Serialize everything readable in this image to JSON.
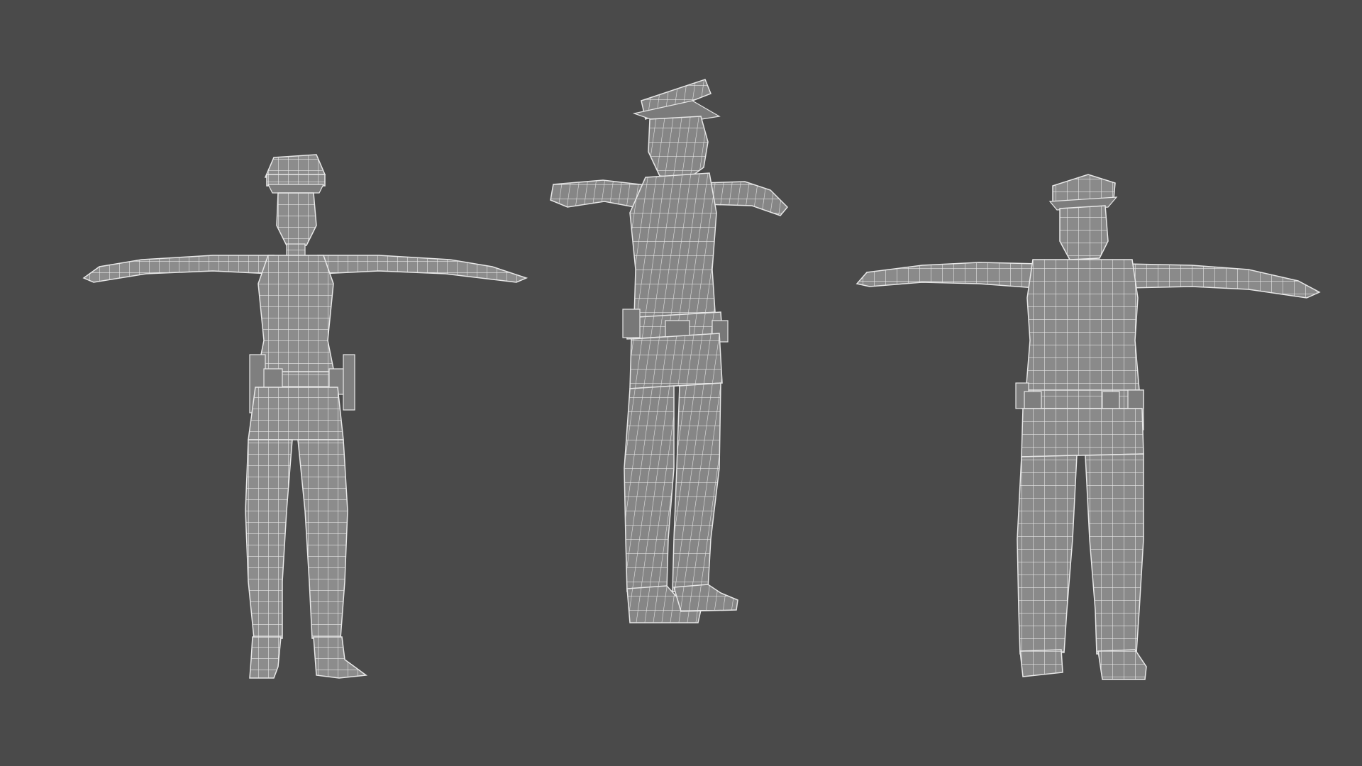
{
  "scene": {
    "background_color": "#4a4a4a",
    "mesh_fill_color": "#8c8c8c",
    "mesh_shade_color": "#7a7a7a",
    "wireframe_color": "#e8e8e8",
    "figures": [
      {
        "name": "female-officer",
        "view": "front",
        "pose": "t-pose",
        "has_cap": true,
        "has_duty_belt": true
      },
      {
        "name": "male-officer",
        "view": "three-quarter",
        "pose": "t-pose",
        "has_cap": true,
        "has_duty_belt": true
      },
      {
        "name": "male-officer",
        "view": "back",
        "pose": "t-pose",
        "has_cap": true,
        "has_duty_belt": true
      }
    ]
  }
}
